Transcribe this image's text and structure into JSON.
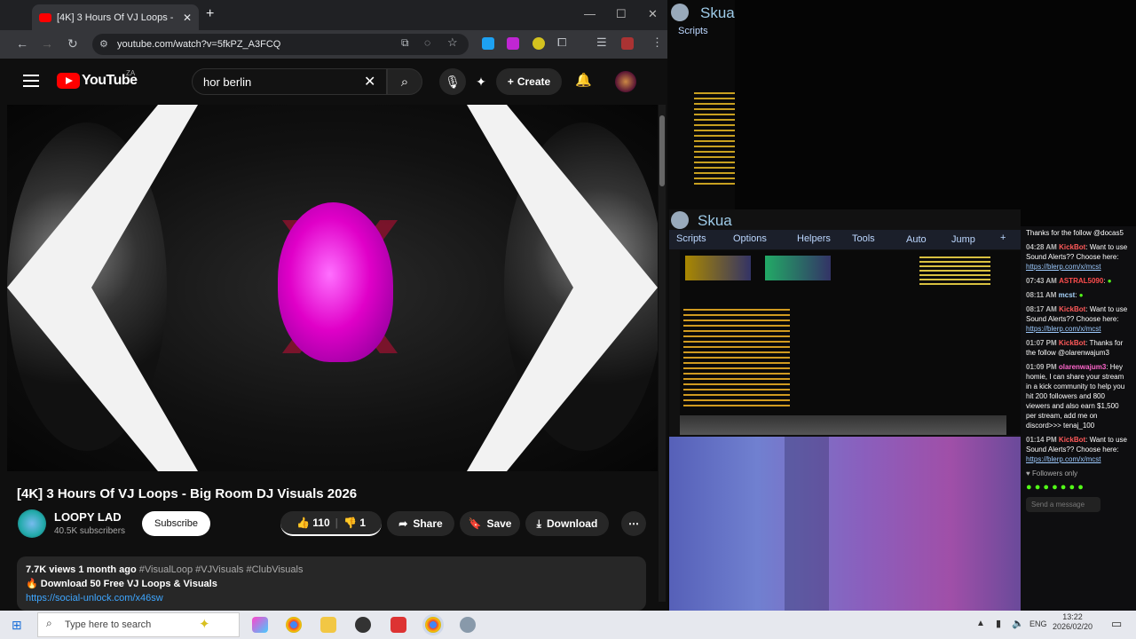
{
  "browser": {
    "tab_title": "[4K] 3 Hours Of VJ Loops -",
    "url": "youtube.com/watch?v=5fkPZ_A3FCQ"
  },
  "youtube": {
    "logo_text": "YouTube",
    "country": "ZA",
    "search_value": "hor berlin",
    "create_label": "Create",
    "video_title": "[4K] 3 Hours Of VJ Loops - Big Room DJ Visuals 2026",
    "channel_name": "LOOPY LAD",
    "subscribers": "40.5K subscribers",
    "subscribe_label": "Subscribe",
    "likes": "110",
    "dislikes": "1",
    "share_label": "Share",
    "save_label": "Save",
    "download_label": "Download",
    "description": {
      "views": "7.7K views",
      "age": "1 month ago",
      "tags": "#VisualLoop #VJVisuals #ClubVisuals",
      "line1": "🔥 Download 50 Free VJ Loops & Visuals",
      "link": "https://social-unlock.com/x46sw"
    }
  },
  "skua_top": {
    "title": "Skua",
    "menu": "Scripts"
  },
  "skua_main": {
    "title": "Skua",
    "menu": [
      "Scripts",
      "Options",
      "Helpers",
      "Tools",
      "Auto",
      "Jump",
      "+"
    ]
  },
  "chat": {
    "messages": [
      {
        "time": "",
        "user": "",
        "text": "Thanks for the follow @docas5"
      },
      {
        "time": "04:28 AM",
        "user": "KickBot",
        "text": "Want to use Sound Alerts?? Choose here:",
        "link": "https://blerp.com/x/mcst"
      },
      {
        "time": "07:43 AM",
        "user": "ASTRAL5090",
        "text": ""
      },
      {
        "time": "08:11 AM",
        "user": "mcst",
        "text": ""
      },
      {
        "time": "08:17 AM",
        "user": "KickBot",
        "text": "Want to use Sound Alerts?? Choose here:",
        "link": "https://blerp.com/x/mcst"
      },
      {
        "time": "01:07 PM",
        "user": "KickBot",
        "text": "Thanks for the follow @olarenwajum3"
      },
      {
        "time": "01:09 PM",
        "user": "olarenwajum3",
        "text": "Hey homie, I can share your stream in a kick community to help you hit 200 followers and 800 viewers and also earn $1,500 per stream, add me on discord>>> tenaj_100"
      },
      {
        "time": "01:14 PM",
        "user": "KickBot",
        "text": "Want to use Sound Alerts?? Choose here:",
        "link": "https://blerp.com/x/mcst"
      }
    ],
    "followers_only": "Followers only",
    "send_placeholder": "Send a message"
  },
  "taskbar": {
    "search_placeholder": "Type here to search",
    "lang": "ENG",
    "time": "13:22",
    "date": "2026/02/20"
  }
}
